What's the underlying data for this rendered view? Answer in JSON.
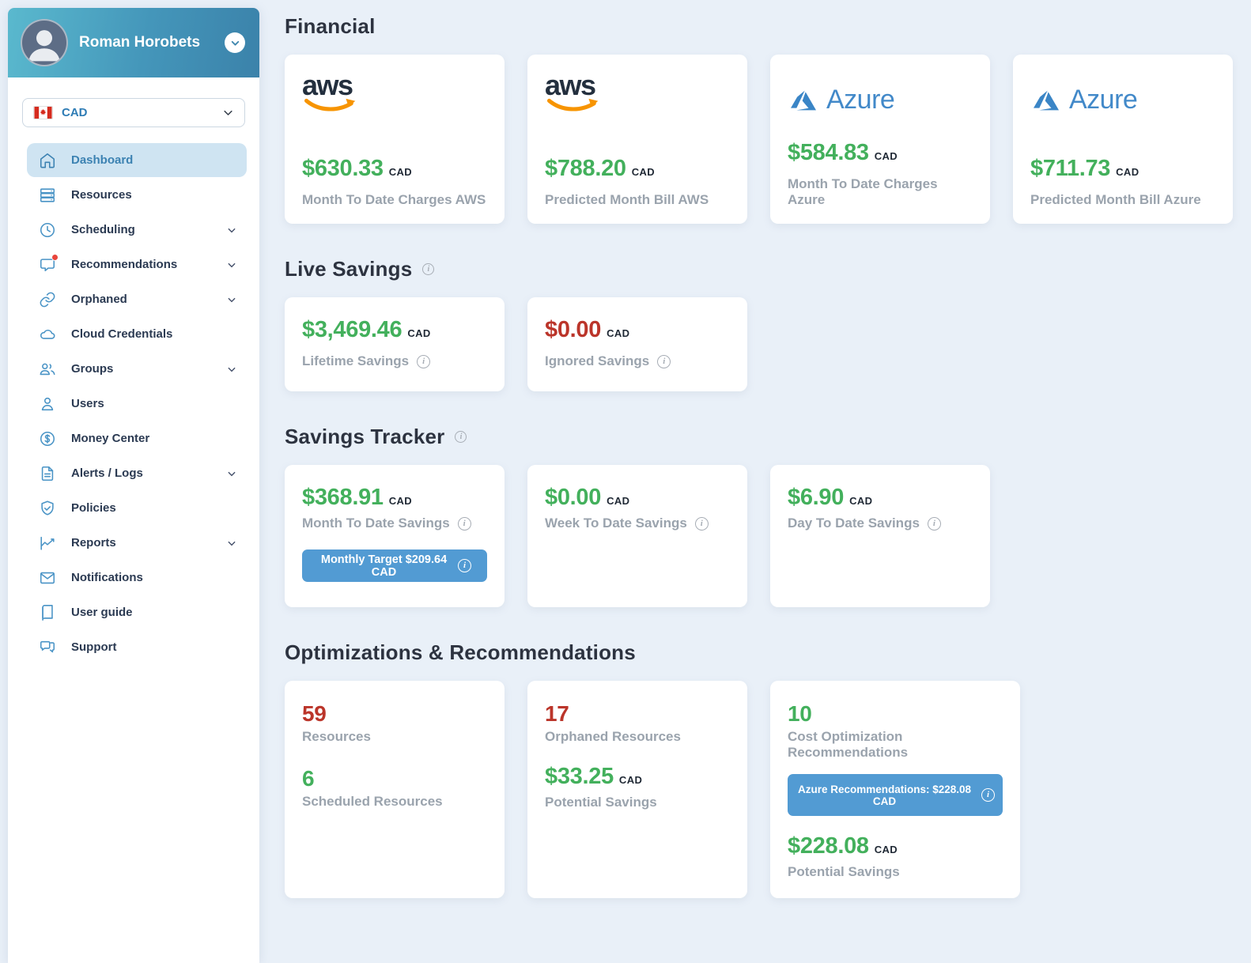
{
  "colors": {
    "positive_green": "#43b05c",
    "negative_red": "#bb352a",
    "accent_blue": "#529bd3",
    "sidebar_icon_blue": "#4a94c6",
    "header_gradient_start": "#5ab9ce",
    "header_gradient_end": "#3b82aa",
    "active_item_bg": "#cfe4f2"
  },
  "user": {
    "name": "Roman Horobets"
  },
  "currency_selector": {
    "value": "CAD",
    "flag": "canada-flag"
  },
  "sidebar": {
    "items": [
      {
        "label": "Dashboard",
        "icon": "home-icon",
        "active": true
      },
      {
        "label": "Resources",
        "icon": "server-icon"
      },
      {
        "label": "Scheduling",
        "icon": "clock-icon",
        "expandable": true
      },
      {
        "label": "Recommendations",
        "icon": "chat-bubble-icon",
        "expandable": true,
        "badge": true
      },
      {
        "label": "Orphaned",
        "icon": "link-icon",
        "expandable": true
      },
      {
        "label": "Cloud Credentials",
        "icon": "cloud-icon"
      },
      {
        "label": "Groups",
        "icon": "people-icon",
        "expandable": true
      },
      {
        "label": "Users",
        "icon": "person-icon"
      },
      {
        "label": "Money Center",
        "icon": "dollar-circle-icon"
      },
      {
        "label": "Alerts / Logs",
        "icon": "document-icon",
        "expandable": true
      },
      {
        "label": "Policies",
        "icon": "shield-check-icon"
      },
      {
        "label": "Reports",
        "icon": "chart-line-icon",
        "expandable": true
      },
      {
        "label": "Notifications",
        "icon": "envelope-icon"
      },
      {
        "label": "User guide",
        "icon": "book-icon"
      },
      {
        "label": "Support",
        "icon": "support-chat-icon"
      }
    ]
  },
  "sections": {
    "financial": {
      "title": "Financial",
      "cards": [
        {
          "provider": "aws",
          "amount": "$630.33",
          "currency": "CAD",
          "label": "Month To Date Charges AWS"
        },
        {
          "provider": "aws",
          "amount": "$788.20",
          "currency": "CAD",
          "label": "Predicted Month Bill AWS"
        },
        {
          "provider": "azure",
          "logo_text": "Azure",
          "amount": "$584.83",
          "currency": "CAD",
          "label": "Month To Date Charges Azure"
        },
        {
          "provider": "azure",
          "logo_text": "Azure",
          "amount": "$711.73",
          "currency": "CAD",
          "label": "Predicted Month Bill Azure"
        }
      ]
    },
    "live_savings": {
      "title": "Live Savings",
      "cards": [
        {
          "amount": "$3,469.46",
          "currency": "CAD",
          "label": "Lifetime Savings",
          "tone": "green"
        },
        {
          "amount": "$0.00",
          "currency": "CAD",
          "label": "Ignored Savings",
          "tone": "red"
        }
      ]
    },
    "savings_tracker": {
      "title": "Savings Tracker",
      "cards": [
        {
          "amount": "$368.91",
          "currency": "CAD",
          "label": "Month To Date Savings",
          "button_label": "Monthly Target $209.64 CAD"
        },
        {
          "amount": "$0.00",
          "currency": "CAD",
          "label": "Week To Date Savings"
        },
        {
          "amount": "$6.90",
          "currency": "CAD",
          "label": "Day To Date Savings"
        }
      ]
    },
    "optimizations": {
      "title": "Optimizations & Recommendations",
      "cards": [
        {
          "stats": [
            {
              "value": "59",
              "tone": "red",
              "label": "Resources"
            },
            {
              "value": "6",
              "tone": "green",
              "label": "Scheduled Resources"
            }
          ]
        },
        {
          "stats": [
            {
              "value": "17",
              "tone": "red",
              "label": "Orphaned Resources"
            }
          ],
          "amount": "$33.25",
          "currency": "CAD",
          "amount_label": "Potential Savings"
        },
        {
          "stats": [
            {
              "value": "10",
              "tone": "green",
              "label": "Cost Optimization Recommendations"
            }
          ],
          "button_label": "Azure Recommendations: $228.08 CAD",
          "amount": "$228.08",
          "currency": "CAD",
          "amount_label": "Potential Savings"
        }
      ]
    }
  }
}
